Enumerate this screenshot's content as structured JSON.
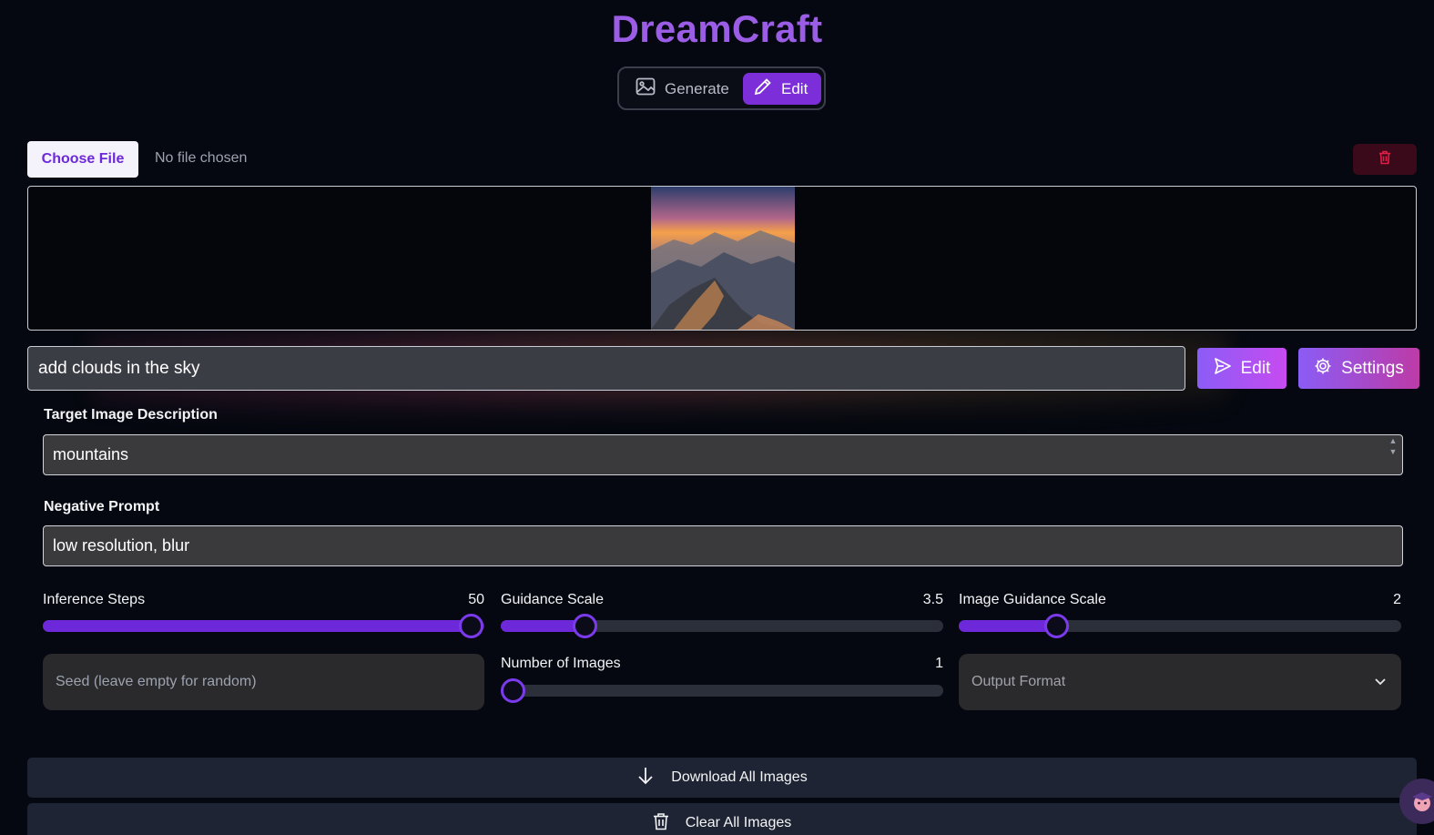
{
  "app": {
    "title": "DreamCraft"
  },
  "mode_switch": {
    "generate_label": "Generate",
    "edit_label": "Edit",
    "active": "Edit"
  },
  "file": {
    "choose_label": "Choose File",
    "status": "No file chosen"
  },
  "prompt": {
    "value": "add clouds in the sky",
    "edit_button": "Edit",
    "settings_button": "Settings"
  },
  "settings": {
    "target_label": "Target Image Description",
    "target_value": "mountains",
    "negative_label": "Negative Prompt",
    "negative_value": "low resolution, blur",
    "sliders": {
      "inference_steps": {
        "label": "Inference Steps",
        "value": "50",
        "fraction": 0.97
      },
      "guidance_scale": {
        "label": "Guidance Scale",
        "value": "3.5",
        "fraction": 0.19
      },
      "image_guidance_scale": {
        "label": "Image Guidance Scale",
        "value": "2",
        "fraction": 0.22
      },
      "number_of_images": {
        "label": "Number of Images",
        "value": "1",
        "fraction": 0.0
      }
    },
    "seed_placeholder": "Seed (leave empty for random)",
    "output_format_placeholder": "Output Format"
  },
  "actions": {
    "download_all": "Download All Images",
    "clear_all": "Clear All Images"
  },
  "colors": {
    "accent": "#7c2fd8",
    "title": "#9b5de5",
    "background": "#050810"
  },
  "icons": {
    "generate": "image-icon",
    "edit": "pencil-icon",
    "delete": "trash-icon",
    "send": "send-icon",
    "settings": "gear-icon",
    "download": "arrow-down-icon",
    "clear": "trash-icon",
    "select": "chevron-down-icon"
  }
}
